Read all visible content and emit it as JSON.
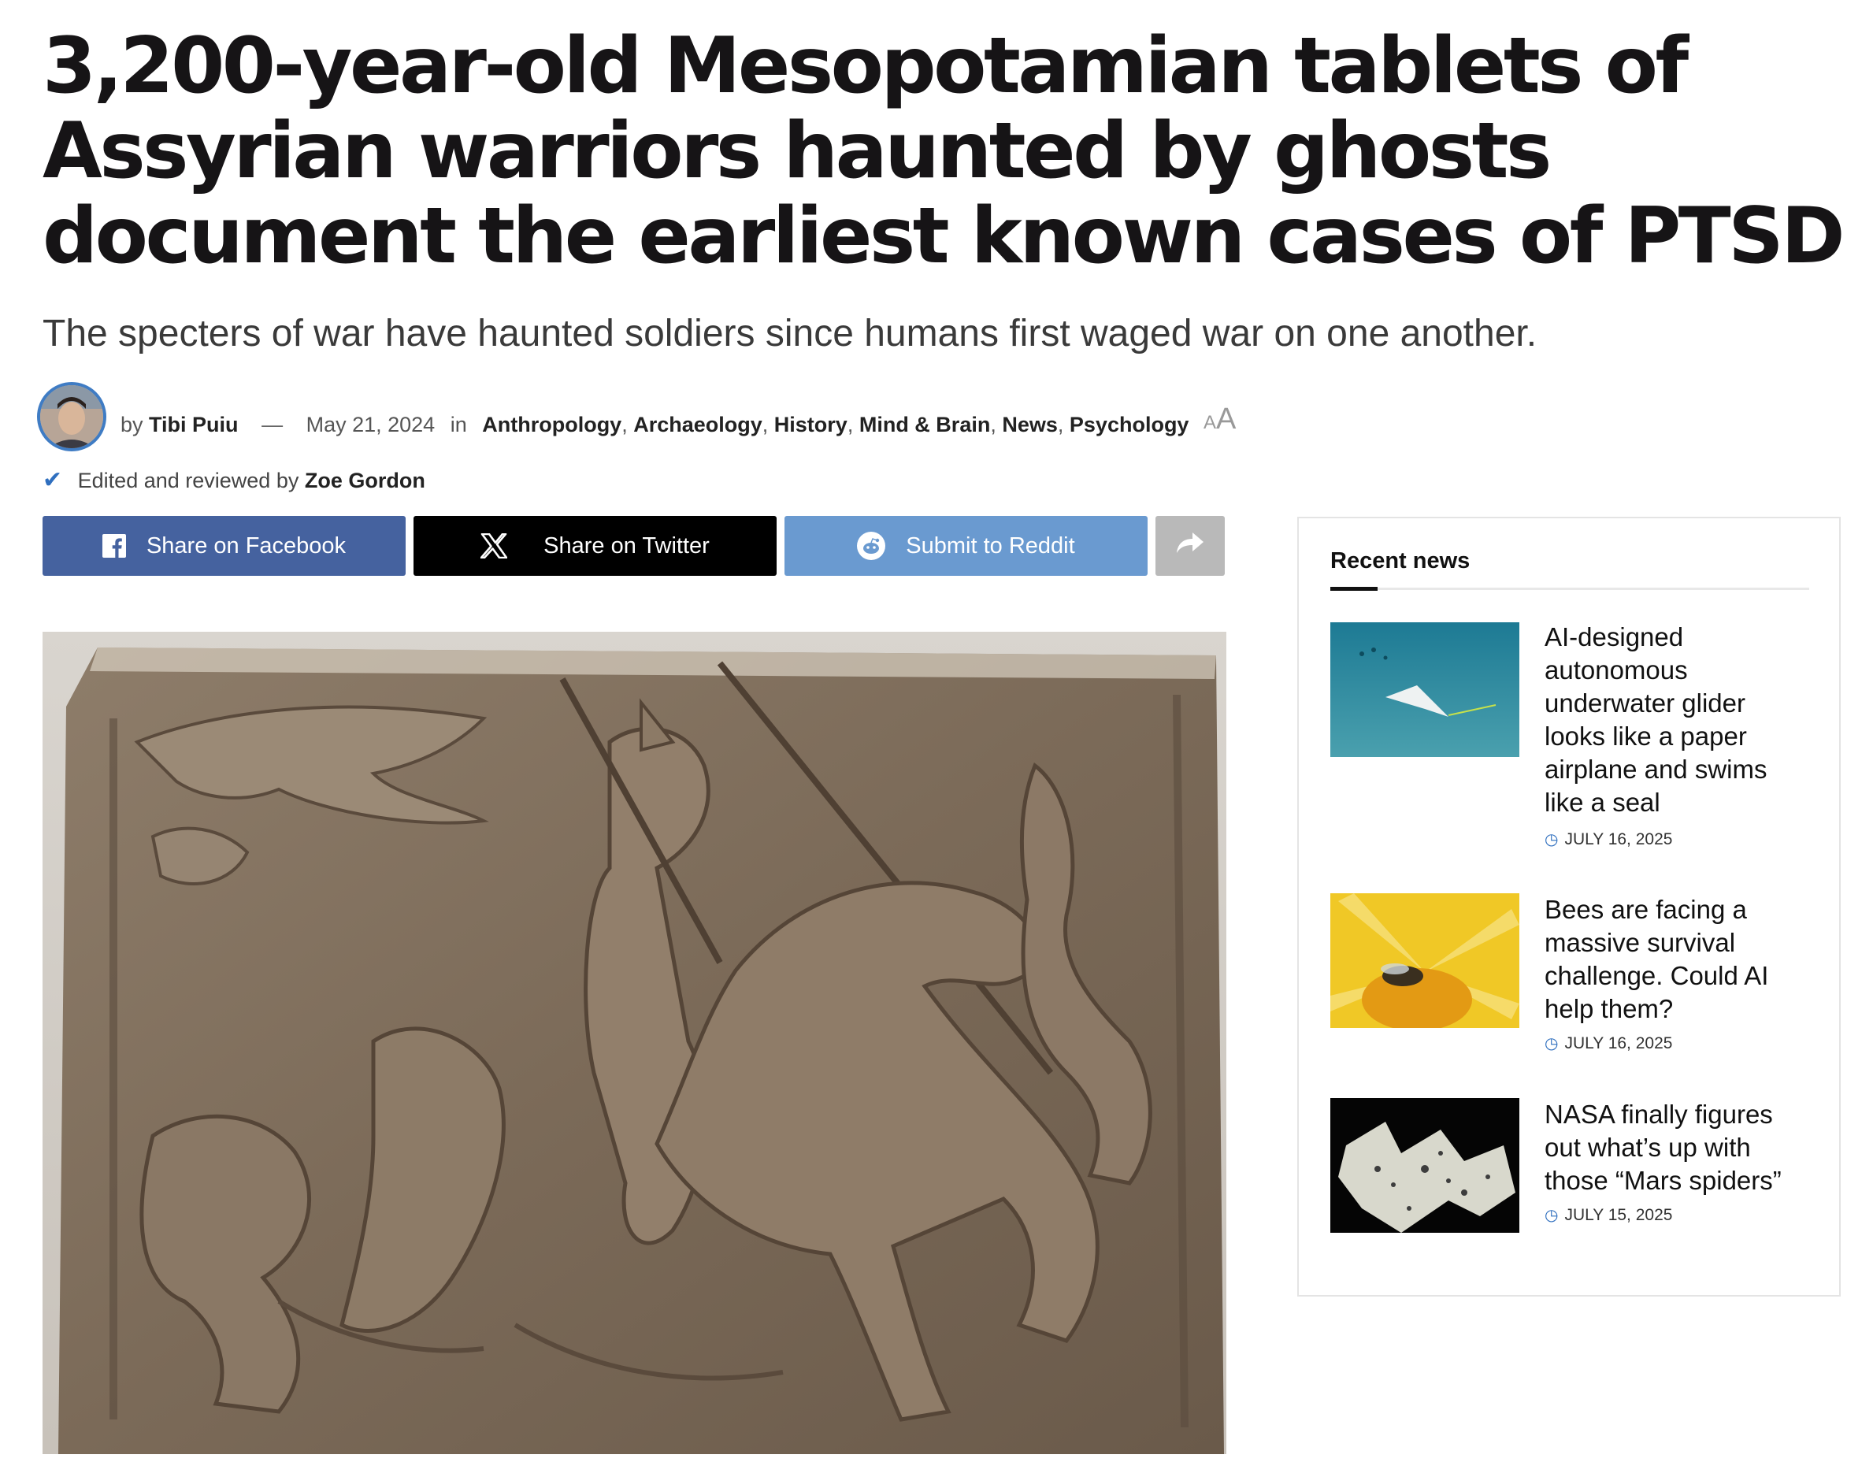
{
  "article": {
    "headline": "3,200-year-old Mesopotamian tablets of Assyrian warriors haunted by ghosts document the earliest known cases of PTSD",
    "subtitle": "The specters of war have haunted soldiers since humans first waged war on one another.",
    "by_label": "by",
    "author": "Tibi Puiu",
    "dash": "—",
    "date": "May 21, 2024",
    "in_label": "in",
    "categories": [
      "Anthropology",
      "Archaeology",
      "History",
      "Mind & Brain",
      "News",
      "Psychology"
    ],
    "font_size_control": {
      "small": "A",
      "large": "A"
    },
    "reviewed_label": "Edited and reviewed by",
    "reviewer": "Zoe Gordon"
  },
  "share": {
    "facebook": "Share on Facebook",
    "twitter": "Share on Twitter",
    "reddit": "Submit to Reddit"
  },
  "sidebar": {
    "title": "Recent news",
    "items": [
      {
        "title": "AI-designed autonomous underwater glider looks like a paper airplane and swims like a seal",
        "date": "JULY 16, 2025",
        "thumb": "underwater glider"
      },
      {
        "title": "Bees are facing a massive survival challenge. Could AI help them?",
        "date": "JULY 16, 2025",
        "thumb": "bee on yellow flower"
      },
      {
        "title": "NASA finally figures out what’s up with those “Mars spiders”",
        "date": "JULY 15, 2025",
        "thumb": "mars spiders"
      }
    ]
  },
  "colors": {
    "facebook": "#45629f",
    "twitter": "#000000",
    "reddit": "#6a9ad0",
    "accent_blue": "#2f6fbf"
  }
}
